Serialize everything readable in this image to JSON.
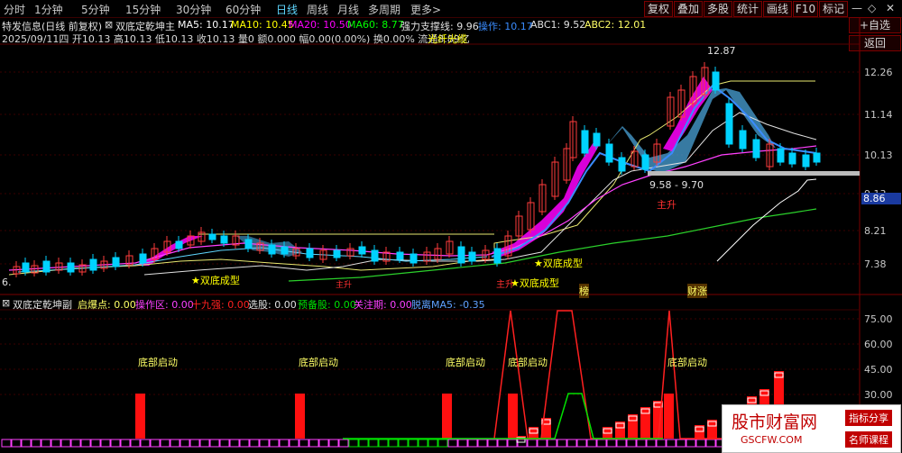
{
  "toolbar": {
    "timeframes": [
      "分时",
      "1分钟",
      "5分钟",
      "15分钟",
      "30分钟",
      "60分钟",
      "日线",
      "周线",
      "月线",
      "多周期",
      "更多>"
    ],
    "active": "日线",
    "right_buttons": [
      "复权",
      "叠加",
      "多股",
      "统计",
      "画线",
      "F10",
      "标记",
      "+自选",
      "返回"
    ],
    "ctrl_icons": [
      "minimize-icon",
      "restore-icon",
      "close-icon"
    ]
  },
  "header": {
    "title": "特发信息(日线 前复权)",
    "indicator": "双底定乾坤主",
    "ma5": "MA5: 10.17",
    "ma10": "MA10: 10.45",
    "ma20": "MA20: 10.50",
    "ma60": "MA60: 8.77",
    "support": "强力支撑线: 9.96",
    "op": "操作: 10.17",
    "abc1": "ABC1: 9.52",
    "abc2": "ABC2: 12.01",
    "date_line": "2025/09/11四 开10.13 高10.13 低10.13 收10.13 量0 额0.000 幅0.00(0.00%) 换0.00% 流通8.89亿",
    "concept": "光纤光缆"
  },
  "main_axis": [
    "12.26",
    "11.14",
    "10.13",
    "9.13",
    "8.21",
    "7.38"
  ],
  "current_price": "8.86",
  "annotations": {
    "high": "12.87",
    "low_prefix": "6.",
    "range": "9.58 - 9.70",
    "zhusheng": "主升",
    "star_labels": [
      "★双底成型",
      "★双底成型",
      "★双底成型"
    ],
    "bottom_tags": [
      "主升",
      "榜",
      "财涨"
    ],
    "red_tag": "主升"
  },
  "sub": {
    "title": "双底定乾坤副",
    "qidian": "启爆点: 0.00",
    "caozuo": "操作区: 0.00",
    "shijiu": "十九强: 0.00",
    "xuangu": "选股: 0.00",
    "yubei": "预备股: 0.00",
    "guanzhu": "关注期: 0.00",
    "beili": "脱离MA5: -0.35",
    "axis": [
      "75.00",
      "60.00",
      "45.00",
      "30.00"
    ],
    "labels": [
      "底部启动",
      "底部启动",
      "底部启动",
      "底部启动",
      "底部启动"
    ]
  },
  "logo": {
    "title": "股市财富网",
    "url": "GSCFW.COM",
    "btn1": "指标分享",
    "btn2": "名师课程"
  },
  "colors": {
    "up": "#ff3c3c",
    "down": "#00d2ff",
    "magenta": "#ff00ff",
    "yellow": "#ffff00",
    "green": "#00ff00"
  }
}
